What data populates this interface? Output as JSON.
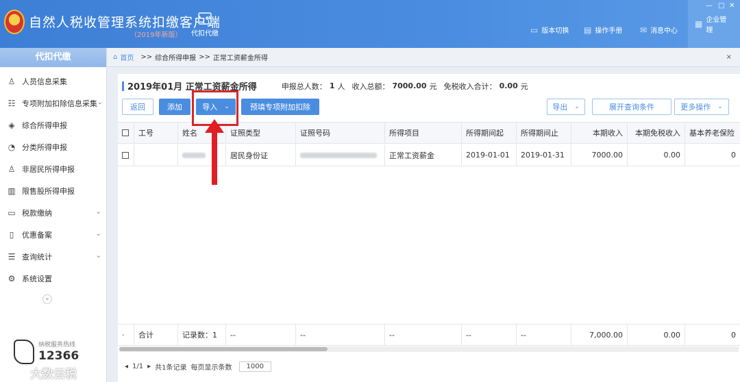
{
  "header": {
    "title": "自然人税收管理系统扣缴客户端",
    "version": "（2019年新版）",
    "module_label": "代扣代缴",
    "nav": [
      {
        "label": "版本切换",
        "icon": "▭"
      },
      {
        "label": "操作手册",
        "icon": "▤"
      },
      {
        "label": "消息中心",
        "icon": "✉"
      },
      {
        "label": "企业管理",
        "icon": "▦"
      }
    ],
    "window_controls": [
      "—",
      "□",
      "✕"
    ]
  },
  "sidebar": {
    "title": "代扣代缴",
    "items": [
      {
        "label": "人员信息采集",
        "icon": "♙",
        "has_children": false
      },
      {
        "label": "专项附加扣除信息采集",
        "icon": "☷",
        "has_children": true
      },
      {
        "label": "综合所得申报",
        "icon": "◈",
        "has_children": false
      },
      {
        "label": "分类所得申报",
        "icon": "◔",
        "has_children": false
      },
      {
        "label": "非居民所得申报",
        "icon": "♙",
        "has_children": false
      },
      {
        "label": "限售股所得申报",
        "icon": "▥",
        "has_children": false
      },
      {
        "label": "税款缴纳",
        "icon": "▭",
        "has_children": true
      },
      {
        "label": "优惠备案",
        "icon": "▯",
        "has_children": true
      },
      {
        "label": "查询统计",
        "icon": "☰",
        "has_children": true
      },
      {
        "label": "系统设置",
        "icon": "⚙",
        "has_children": false
      }
    ],
    "collapse": "«",
    "hotline_label": "纳税服务热线",
    "hotline_number": "12366",
    "watermark": "大数云税"
  },
  "breadcrumb": {
    "home": "首页",
    "sep": ">>",
    "level1": "综合所得申报",
    "level2": "正常工资薪金所得",
    "close": "×"
  },
  "summary": {
    "title": "2019年01月 正常工资薪金所得",
    "total_people_label": "申报总人数：",
    "total_people": "1",
    "people_unit": "人",
    "income_label": "收入总额：",
    "income": "7000.00",
    "income_unit": "元",
    "exempt_label": "免税收入合计：",
    "exempt": "0.00",
    "exempt_unit": "元"
  },
  "toolbar": {
    "back": "返回",
    "add": "添加",
    "import": "导入",
    "prefill": "预填专项附加扣除",
    "export": "导出",
    "expand_query": "展开查询条件",
    "more": "更多操作"
  },
  "table": {
    "columns": [
      "工号",
      "姓名",
      "证照类型",
      "证照号码",
      "所得项目",
      "所得期间起",
      "所得期间止",
      "本期收入",
      "本期免税收入",
      "基本养老保险"
    ],
    "rows": [
      {
        "id_type": "居民身份证",
        "item": "正常工资薪金",
        "start": "2019-01-01",
        "end": "2019-01-31",
        "income": "7000.00",
        "exempt": "0.00",
        "pension": "0"
      }
    ],
    "footer": {
      "label": "合计",
      "count": "记录数：1",
      "dash": "--",
      "income": "7,000.00",
      "exempt": "0.00",
      "pension": "0"
    }
  },
  "pager": {
    "page": "1/1",
    "records": "共1条记录",
    "per_page_label": "每页显示条数",
    "per_page": "1000"
  }
}
